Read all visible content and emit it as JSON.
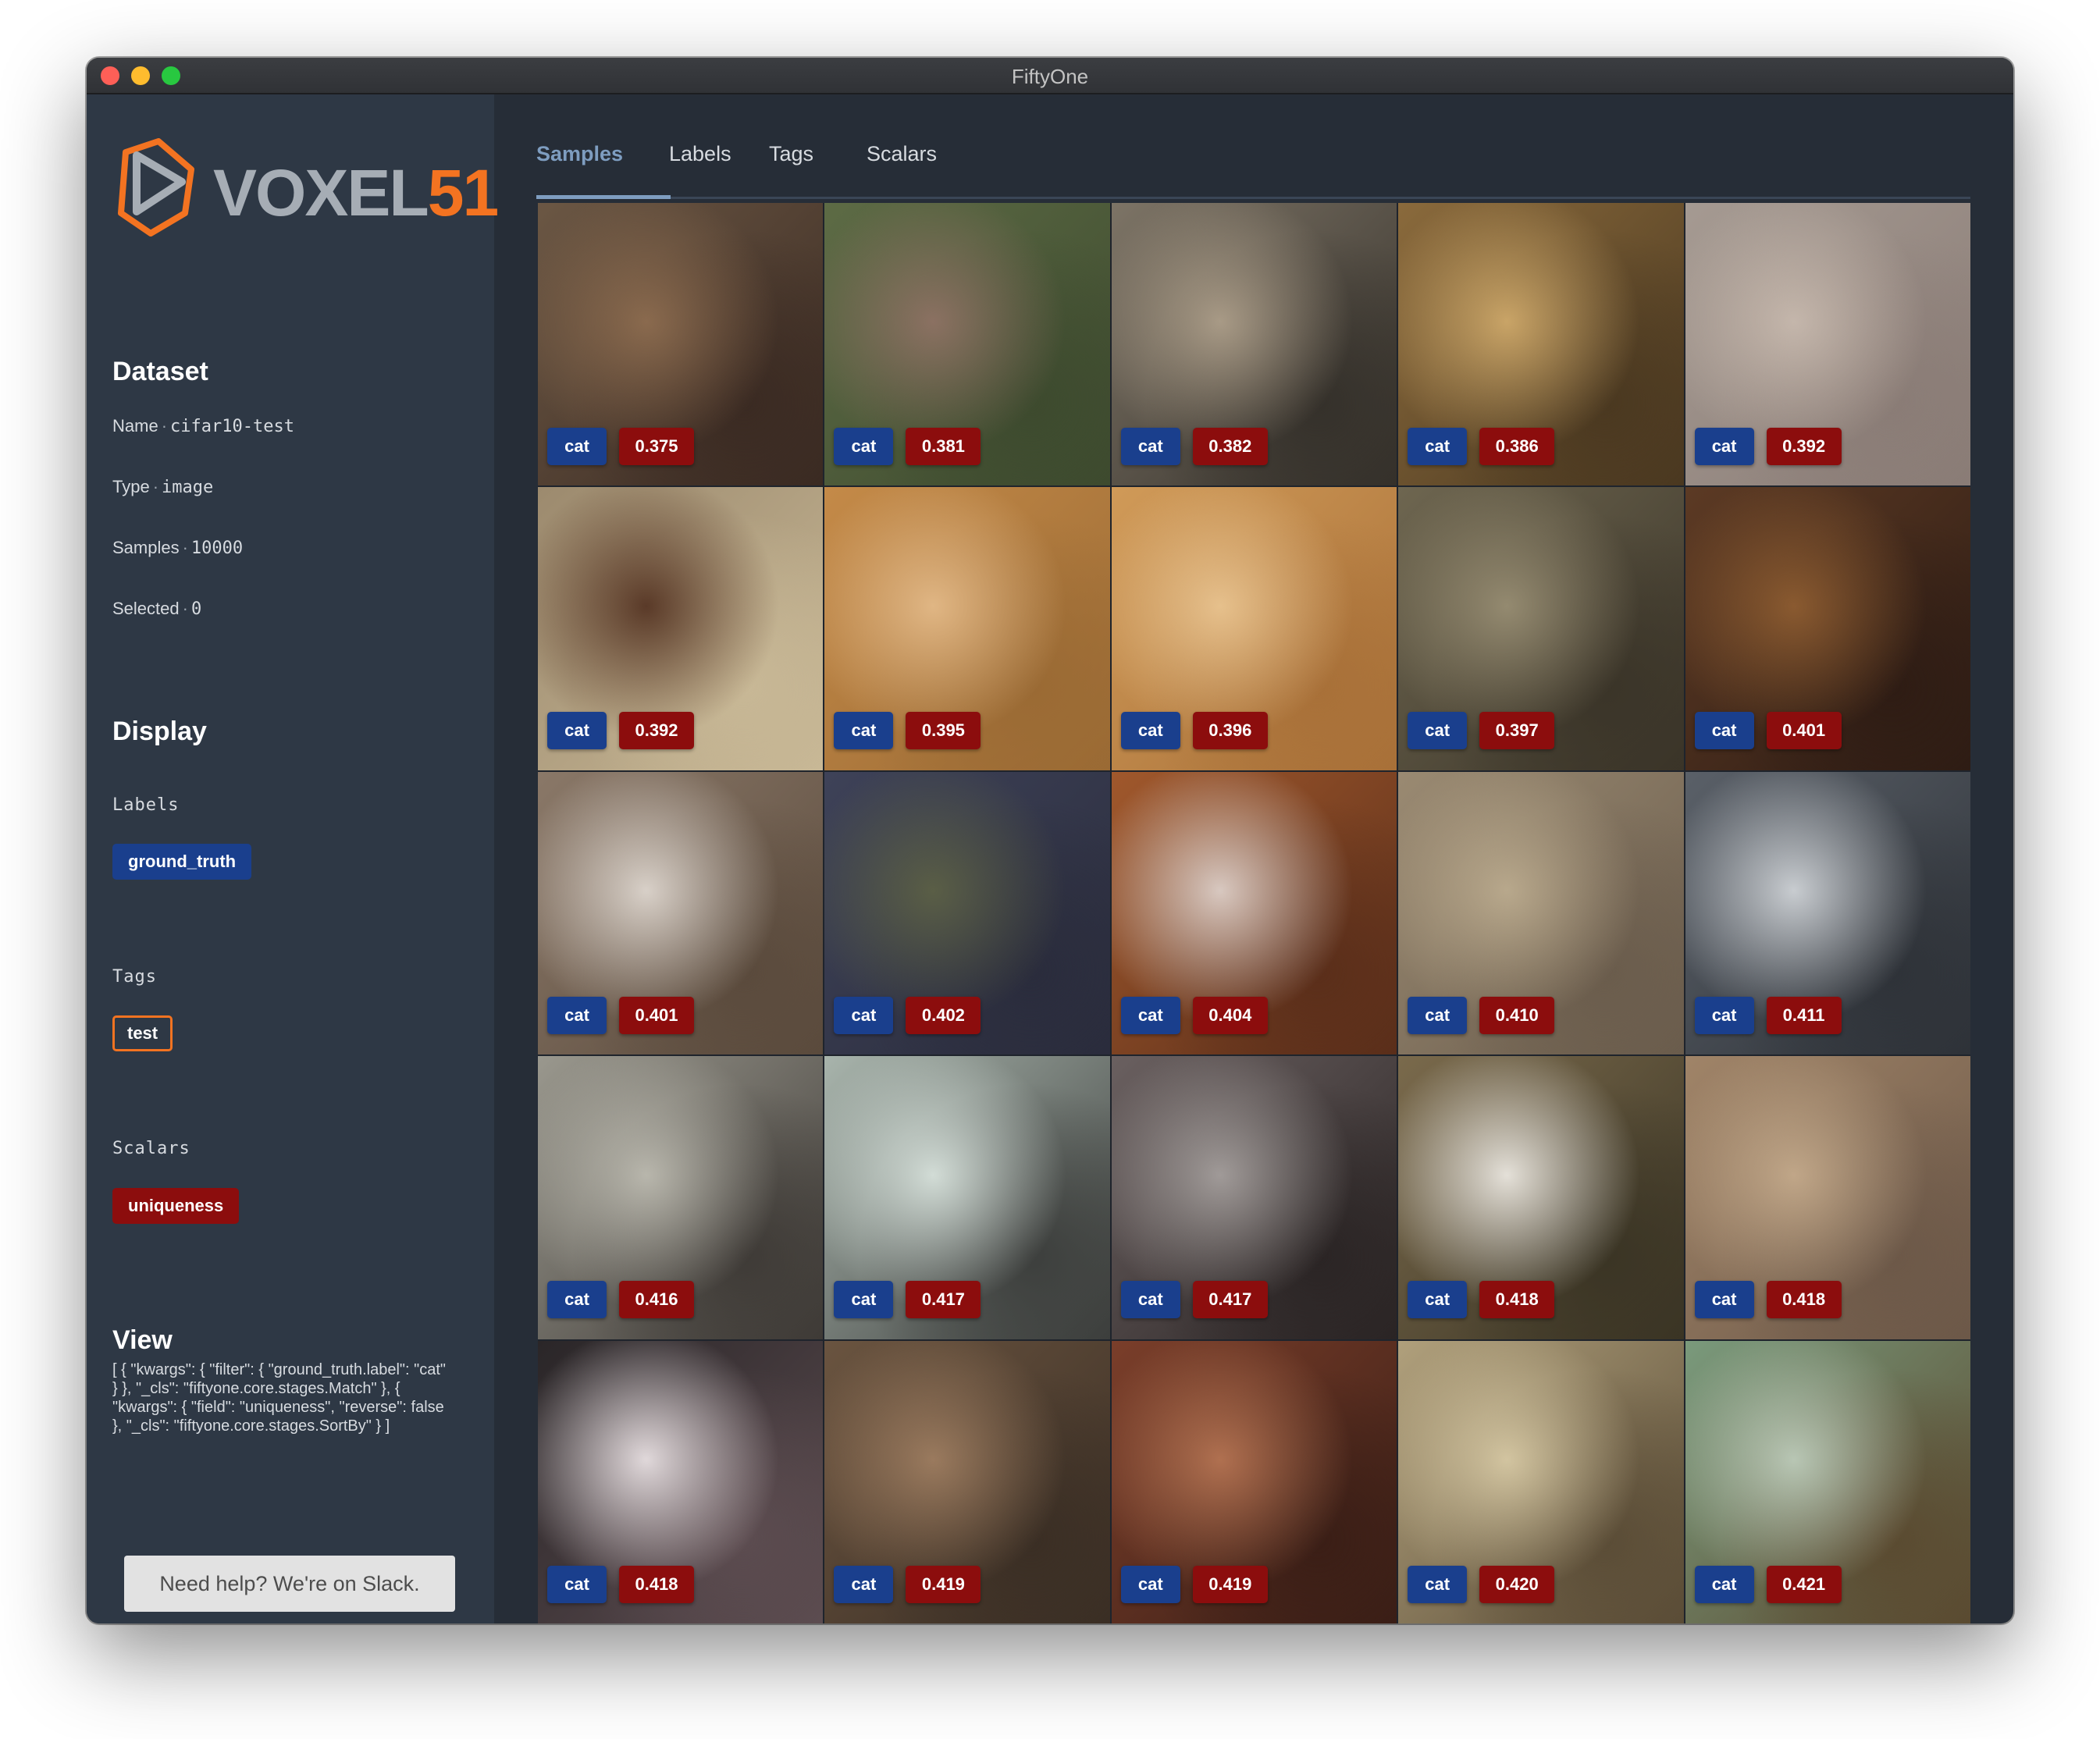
{
  "window": {
    "title": "FiftyOne"
  },
  "logo": {
    "text_main": "VOXEL",
    "text_accent": "51"
  },
  "sidebar": {
    "dataset": {
      "heading": "Dataset",
      "name_label": "Name",
      "name_value": "cifar10-test",
      "type_label": "Type",
      "type_value": "image",
      "samples_label": "Samples",
      "samples_value": "10000",
      "selected_label": "Selected",
      "selected_value": "0",
      "separator": "·"
    },
    "display": {
      "heading": "Display",
      "labels_heading": "Labels",
      "labels_chip": "ground_truth",
      "tags_heading": "Tags",
      "tags_chip": "test",
      "scalars_heading": "Scalars",
      "scalars_chip": "uniqueness"
    },
    "view": {
      "heading": "View",
      "json": "[ { \"kwargs\": { \"filter\": { \"ground_truth.label\": \"cat\" } }, \"_cls\": \"fiftyone.core.stages.Match\" }, { \"kwargs\": { \"field\": \"uniqueness\", \"reverse\": false }, \"_cls\": \"fiftyone.core.stages.SortBy\" } ]"
    },
    "help_button": "Need help? We're on Slack."
  },
  "tabs": [
    {
      "label": "Samples",
      "active": true
    },
    {
      "label": "Labels",
      "active": false
    },
    {
      "label": "Tags",
      "active": false
    },
    {
      "label": "Scalars",
      "active": false
    }
  ],
  "samples": [
    {
      "label": "cat",
      "score": "0.375",
      "colors": [
        "#6b5744",
        "#8a6a4e",
        "#3a2a22"
      ]
    },
    {
      "label": "cat",
      "score": "0.381",
      "colors": [
        "#5d6b45",
        "#8b7162",
        "#3d4a2e"
      ]
    },
    {
      "label": "cat",
      "score": "0.382",
      "colors": [
        "#7d7466",
        "#a89a86",
        "#34302a"
      ]
    },
    {
      "label": "cat",
      "score": "0.386",
      "colors": [
        "#8a6a3c",
        "#c9a467",
        "#4a3820"
      ]
    },
    {
      "label": "cat",
      "score": "0.392",
      "colors": [
        "#a59a92",
        "#c4b6ab",
        "#8a7c76"
      ]
    },
    {
      "label": "cat",
      "score": "0.392",
      "colors": [
        "#9c8a6e",
        "#5a3a28",
        "#c8b896"
      ]
    },
    {
      "label": "cat",
      "score": "0.395",
      "colors": [
        "#c48a48",
        "#e0b684",
        "#9a6a34"
      ]
    },
    {
      "label": "cat",
      "score": "0.396",
      "colors": [
        "#d09a58",
        "#e6c08c",
        "#a87038"
      ]
    },
    {
      "label": "cat",
      "score": "0.397",
      "colors": [
        "#6e6650",
        "#948a70",
        "#3a3428"
      ]
    },
    {
      "label": "cat",
      "score": "0.401",
      "colors": [
        "#5c3a24",
        "#8a5a30",
        "#2e1c14"
      ]
    },
    {
      "label": "cat",
      "score": "0.401",
      "colors": [
        "#8a7868",
        "#d8d0c8",
        "#5a4a3c"
      ]
    },
    {
      "label": "cat",
      "score": "0.402",
      "colors": [
        "#3e4258",
        "#5a5e46",
        "#2a2c3c"
      ]
    },
    {
      "label": "cat",
      "score": "0.404",
      "colors": [
        "#a0582c",
        "#d8c8c0",
        "#5a2e1a"
      ]
    },
    {
      "label": "cat",
      "score": "0.410",
      "colors": [
        "#9a8a72",
        "#b8a88c",
        "#6a5c4c"
      ]
    },
    {
      "label": "cat",
      "score": "0.411",
      "colors": [
        "#5a6068",
        "#c8ccd0",
        "#2e3238"
      ]
    },
    {
      "label": "cat",
      "score": "0.416",
      "colors": [
        "#9a988e",
        "#b8b6ac",
        "#3e3a36"
      ]
    },
    {
      "label": "cat",
      "score": "0.417",
      "colors": [
        "#a8b4ac",
        "#d2dcd6",
        "#3c3e3c"
      ]
    },
    {
      "label": "cat",
      "score": "0.417",
      "colors": [
        "#6a6060",
        "#a09a98",
        "#2a2424"
      ]
    },
    {
      "label": "cat",
      "score": "0.418",
      "colors": [
        "#7a6a4c",
        "#e4e0d8",
        "#3a3424"
      ]
    },
    {
      "label": "cat",
      "score": "0.418",
      "colors": [
        "#a08468",
        "#c0a688",
        "#6c5848"
      ]
    },
    {
      "label": "cat",
      "score": "0.418",
      "colors": [
        "#2a2628",
        "#e0d8da",
        "#5c4c50"
      ]
    },
    {
      "label": "cat",
      "score": "0.419",
      "colors": [
        "#6a5440",
        "#9a7a5e",
        "#3a2e24"
      ]
    },
    {
      "label": "cat",
      "score": "0.419",
      "colors": [
        "#7a3e2a",
        "#b07050",
        "#3a1e16"
      ]
    },
    {
      "label": "cat",
      "score": "0.420",
      "colors": [
        "#b0a07c",
        "#d2c4a0",
        "#5a4c36"
      ]
    },
    {
      "label": "cat",
      "score": "0.421",
      "colors": [
        "#7a9a7c",
        "#b8c6b4",
        "#5a4a30"
      ]
    }
  ]
}
